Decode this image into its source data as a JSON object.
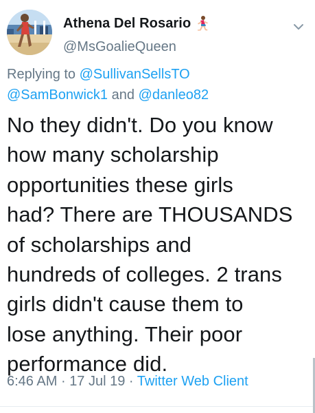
{
  "tweet": {
    "author": {
      "display_name": "Athena Del Rosario",
      "name_emoji_icon": "runner-emoji-icon",
      "handle": "@MsGoalieQueen",
      "avatar_icon": "profile-photo"
    },
    "menu_icon": "chevron-down-icon",
    "reply": {
      "prefix": "Replying to",
      "mention_1": "@SullivanSellsTO",
      "mention_2": "@SamBonwick1",
      "and_word": "and",
      "mention_3": "@danleo82"
    },
    "text_lines": [
      "No they didn't. Do you know",
      "how many scholarship",
      "opportunities these girls",
      "had?  There are THOUSANDS",
      "of scholarships and",
      "hundreds of colleges. 2 trans",
      "girls didn't cause them to",
      "lose anything. Their poor",
      "performance did."
    ],
    "meta": {
      "time": "6:46 AM",
      "separator": "·",
      "date": "17 Jul 19",
      "client": "Twitter Web Client"
    }
  },
  "colors": {
    "text": "#14171a",
    "secondary": "#657786",
    "link": "#1da1f2"
  }
}
